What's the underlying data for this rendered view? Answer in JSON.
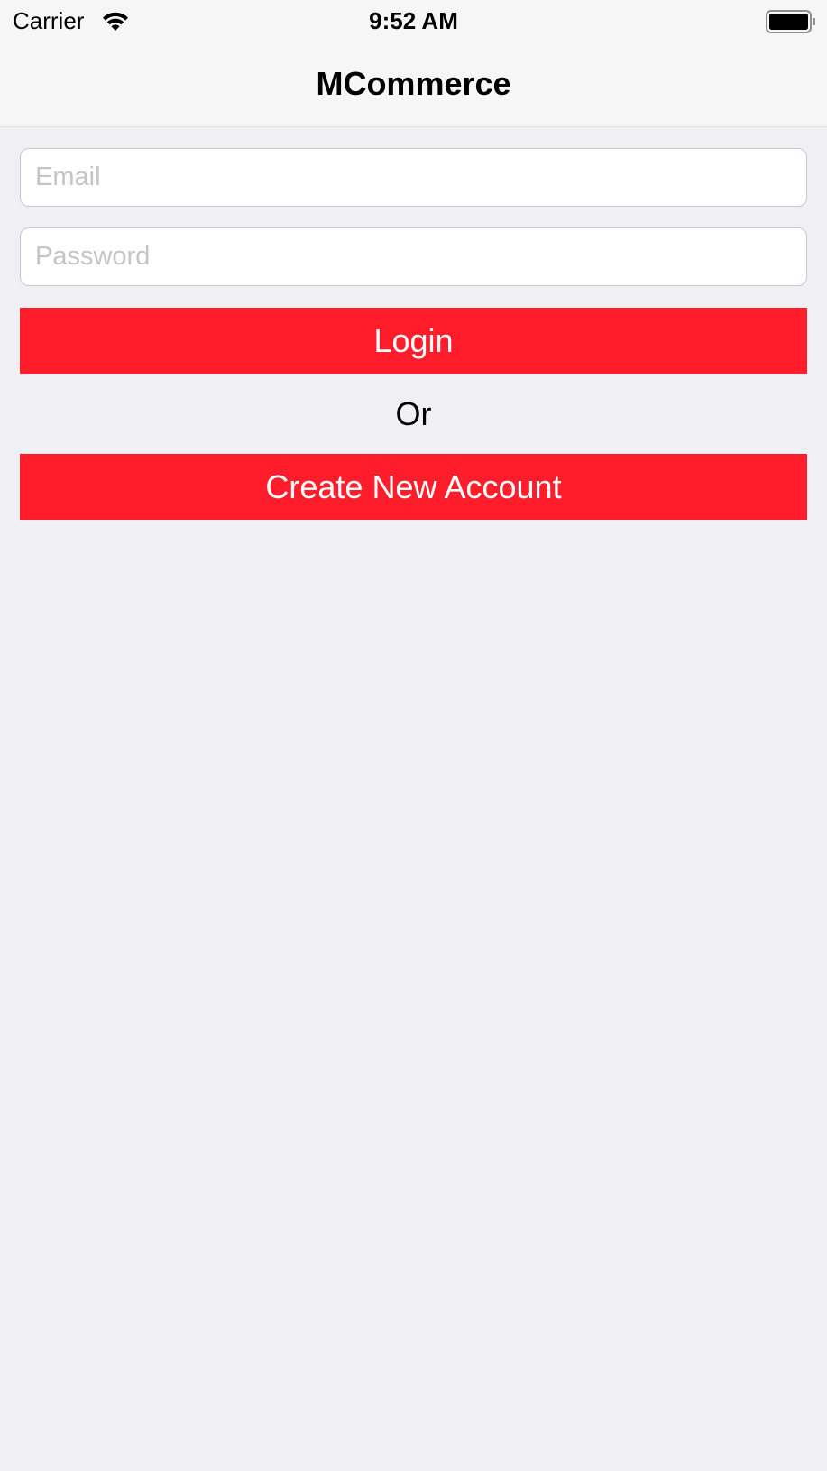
{
  "status_bar": {
    "carrier": "Carrier",
    "time": "9:52 AM",
    "wifi_icon": "wifi-icon",
    "battery_icon": "battery-icon"
  },
  "nav": {
    "title": "MCommerce"
  },
  "form": {
    "email": {
      "value": "",
      "placeholder": "Email"
    },
    "password": {
      "value": "",
      "placeholder": "Password"
    },
    "login_label": "Login",
    "or_label": "Or",
    "create_account_label": "Create New Account"
  },
  "colors": {
    "accent": "#ff1d2c",
    "background": "#efeff4",
    "bar_background": "#f6f6f7",
    "placeholder": "#c4c4c9"
  }
}
